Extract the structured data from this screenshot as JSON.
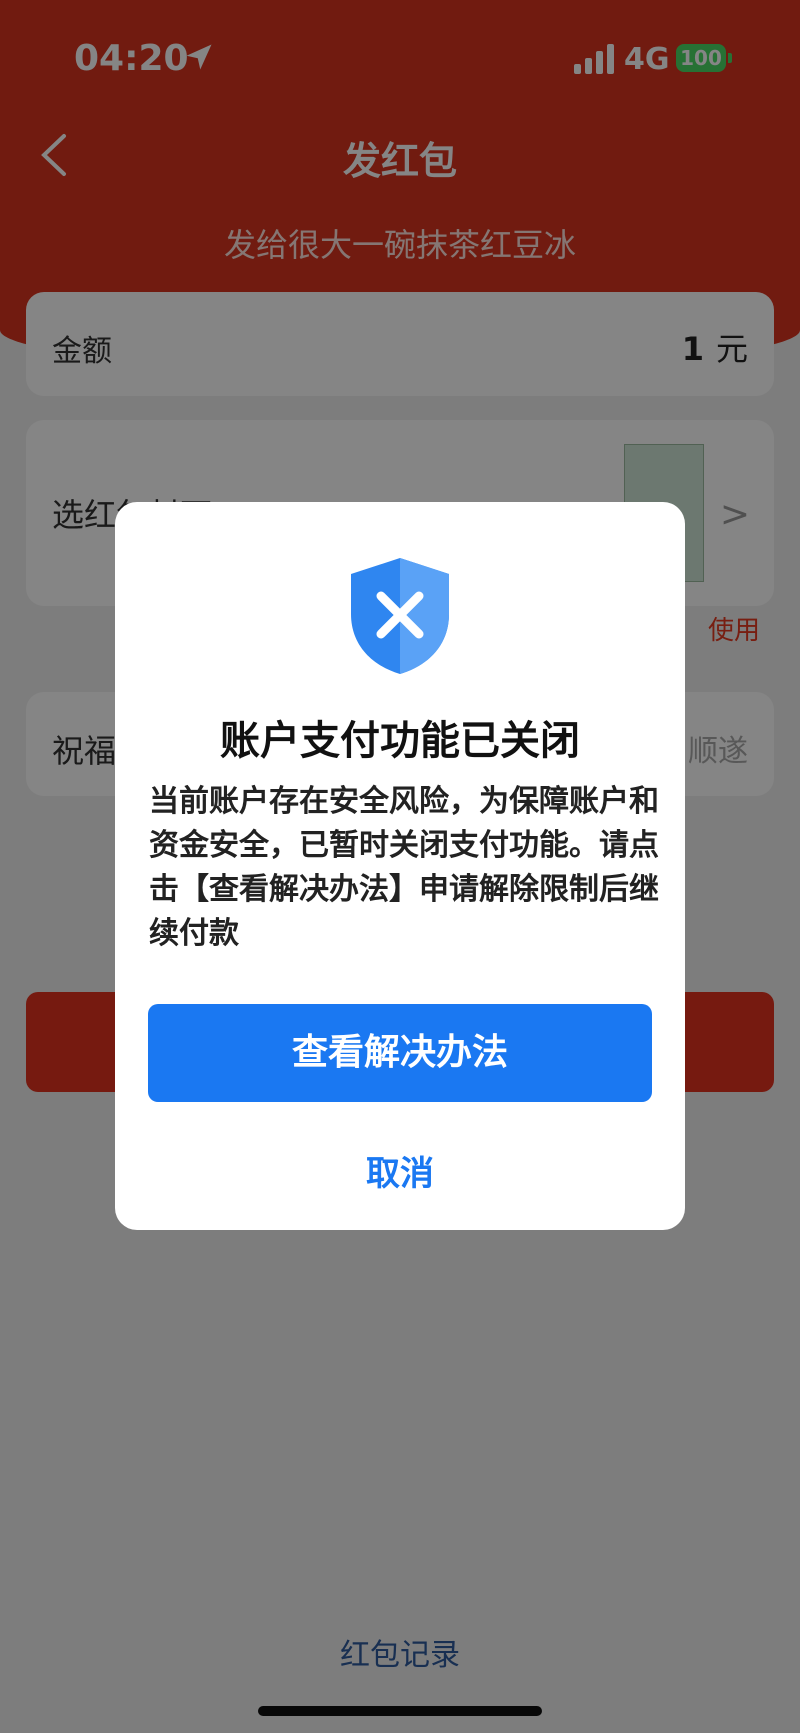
{
  "status_bar": {
    "time": "04:20",
    "network": "4G",
    "battery": "100"
  },
  "header": {
    "title": "发红包",
    "subtitle": "发给很大一碗抹茶红豆冰"
  },
  "amount": {
    "label": "金额",
    "value": "1",
    "unit": "元"
  },
  "cover": {
    "label": "选红包封面",
    "use_tag": "使用"
  },
  "blessing": {
    "label": "祝福",
    "placeholder": "顺遂"
  },
  "footer": {
    "records": "红包记录"
  },
  "dialog": {
    "title": "账户支付功能已关闭",
    "body": "当前账户存在安全风险，为保障账户和资金安全，已暂时关闭支付功能。请点击【查看解决办法】申请解除限制后继续付款",
    "primary_button": "查看解决办法",
    "cancel_button": "取消"
  },
  "colors": {
    "brand_red": "#d9341f",
    "accent_blue": "#1a78f2"
  }
}
